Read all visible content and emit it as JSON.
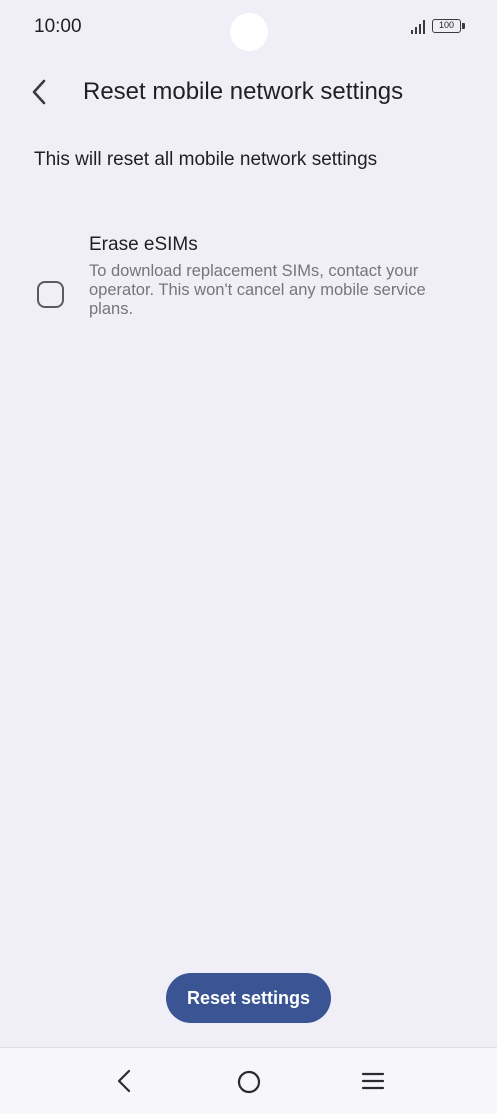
{
  "status_bar": {
    "time": "10:00",
    "battery_level": "100",
    "signal_icon": "signal-bars-icon",
    "battery_icon": "battery-icon"
  },
  "app_bar": {
    "back_icon": "chevron-left-icon",
    "title": "Reset mobile network settings"
  },
  "content": {
    "description": "This will reset all mobile network settings",
    "options": [
      {
        "title": "Erase eSIMs",
        "subtitle": "To download replacement SIMs, contact your operator. This won't cancel any mobile service plans.",
        "checked": false
      }
    ]
  },
  "actions": {
    "reset_label": "Reset settings",
    "accent_color": "#3b5493"
  },
  "nav_bar": {
    "back_icon": "nav-back-icon",
    "home_icon": "nav-home-icon",
    "recent_icon": "nav-recent-apps-icon"
  }
}
